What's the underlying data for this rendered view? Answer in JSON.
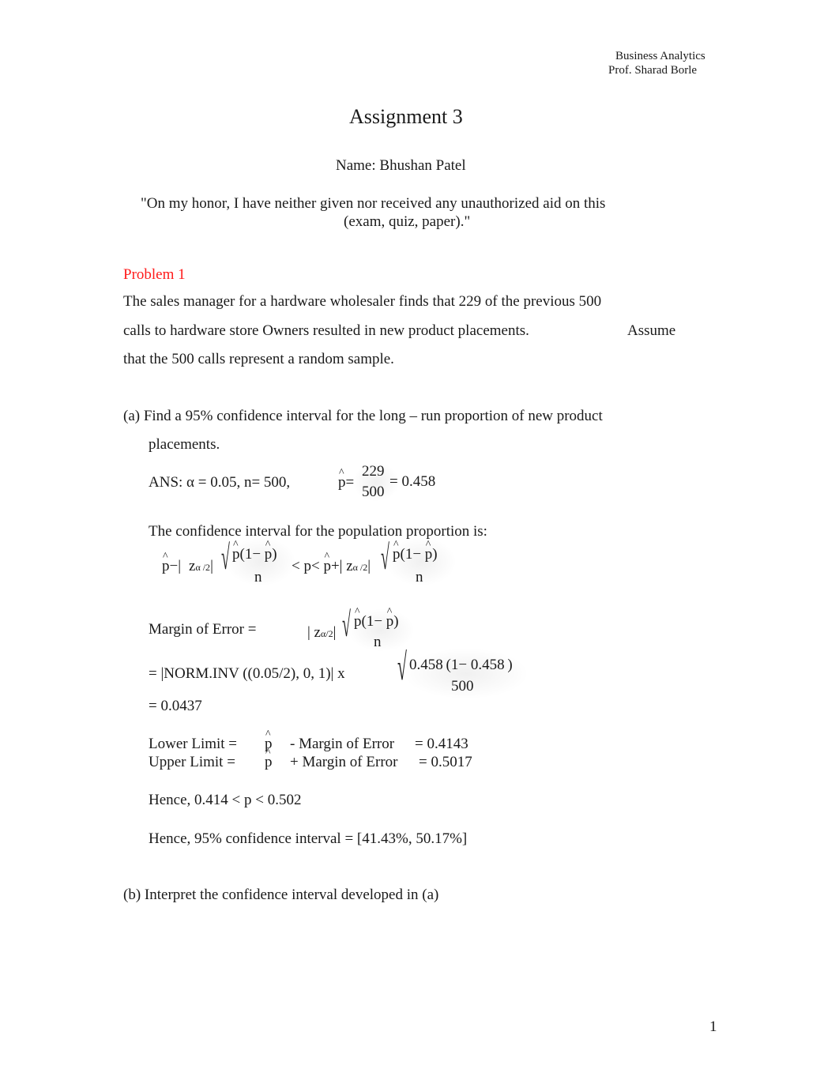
{
  "header": {
    "course": "Business Analytics",
    "professor": "Prof. Sharad Borle"
  },
  "title": "Assignment 3",
  "name_line": "Name: Bhushan Patel",
  "honor_code": {
    "line1": "\"On my honor, I have neither given nor received any unauthorized aid on this",
    "line2": "(exam, quiz, paper).\""
  },
  "problem": {
    "heading": "Problem 1",
    "heading_color": "#ff1a1a",
    "statement": {
      "line1": "The sales manager for a hardware wholesaler finds that 229 of the previous 500",
      "line2a": "calls to hardware store Owners resulted in new product placements.",
      "line2b": "Assume",
      "line3": "that the 500 calls represent a random sample."
    },
    "part_a": {
      "question_line1": "(a) Find a 95% confidence interval for the long – run proportion of new product",
      "question_line2": "placements.",
      "ans_prefix": "ANS: α = 0.05, n= 500,",
      "phat_symbol": "p",
      "phat_eq": "=",
      "phat_numerator": "229",
      "phat_denominator": "500",
      "phat_result": "= 0.458",
      "ci_intro": "The confidence interval for the population proportion is:",
      "formula": {
        "lhs_minus": "−|",
        "z": "z",
        "z_sub": "α /2",
        "abs_close": "|",
        "numerator": "(1− ",
        "numerator_close": ")",
        "denominator": "n",
        "middle": "< p< ",
        "plus": "+| z",
        "z_sub2": "α /2"
      },
      "moe_label": "Margin of Error =",
      "moe_formula": {
        "z": "| z",
        "z_sub": "α/2",
        "abs_close": "|",
        "numerator": "(1− ",
        "numerator_close": ")",
        "denominator": "n"
      },
      "moe_calc_prefix": "= |NORM.INV ((0.05/2), 0, 1)| x",
      "moe_calc_numerator": "0.458 (1− 0.458 )",
      "moe_calc_denominator": "500",
      "moe_value": "= 0.0437",
      "lower_label": "Lower Limit =",
      "lower_expr": "- Margin of Error",
      "lower_value": "= 0.4143",
      "upper_label": "Upper Limit =",
      "upper_expr": "+ Margin of Error",
      "upper_value": "= 0.5017",
      "hence_range": "Hence, 0.414 < p < 0.502",
      "hence_ci": "Hence, 95% confidence interval = [41.43%, 50.17%]"
    },
    "part_b": {
      "question": "(b) Interpret the confidence interval developed in (a)"
    }
  },
  "page_number": "1"
}
